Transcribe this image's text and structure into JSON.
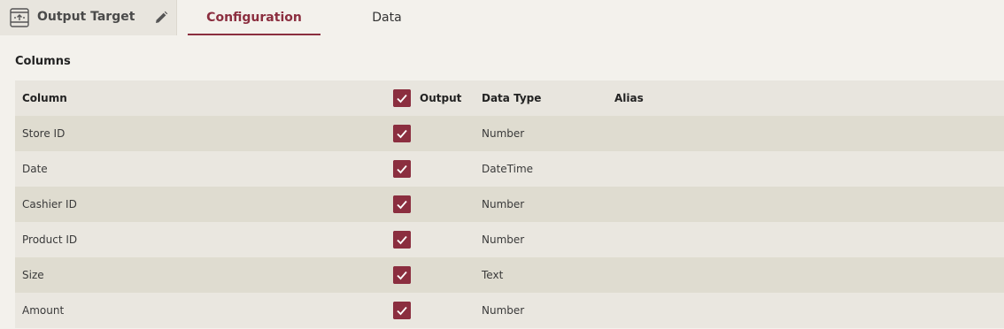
{
  "header": {
    "title": "Output Target",
    "tabs": [
      {
        "label": "Configuration",
        "active": true
      },
      {
        "label": "Data",
        "active": false
      }
    ]
  },
  "section": {
    "title": "Columns"
  },
  "table": {
    "headers": {
      "column": "Column",
      "output": "Output",
      "data_type": "Data Type",
      "alias": "Alias"
    },
    "header_checked": true,
    "rows": [
      {
        "column": "Store ID",
        "output": true,
        "data_type": "Number",
        "alias": ""
      },
      {
        "column": "Date",
        "output": true,
        "data_type": "DateTime",
        "alias": ""
      },
      {
        "column": "Cashier ID",
        "output": true,
        "data_type": "Number",
        "alias": ""
      },
      {
        "column": "Product ID",
        "output": true,
        "data_type": "Number",
        "alias": ""
      },
      {
        "column": "Size",
        "output": true,
        "data_type": "Text",
        "alias": ""
      },
      {
        "column": "Amount",
        "output": true,
        "data_type": "Number",
        "alias": ""
      }
    ]
  },
  "icons": {
    "title": "output-target-icon",
    "edit": "pencil-icon",
    "check": "checkmark-icon"
  },
  "colors": {
    "accent": "#8b2e3f",
    "row_alt": "#dfdcd0",
    "row": "#eae7e0",
    "header_bg": "#e8e5de"
  }
}
